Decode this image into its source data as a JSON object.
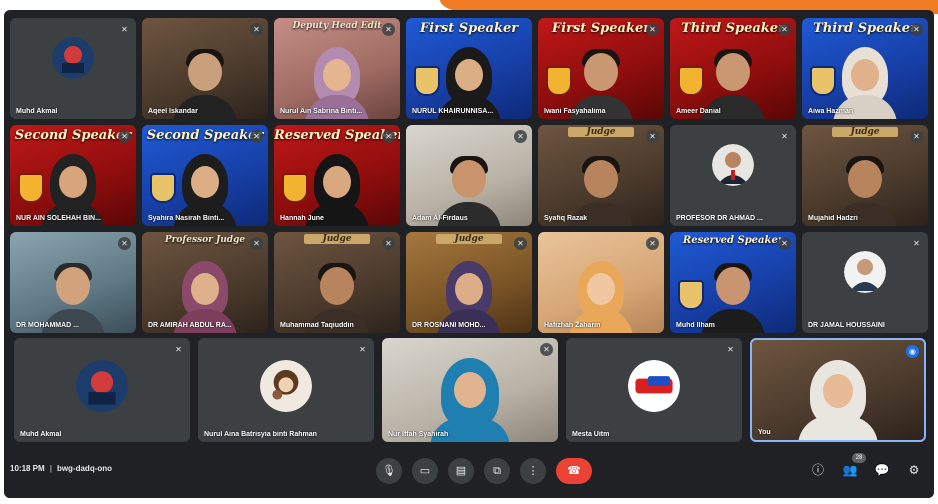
{
  "meeting": {
    "time": "10:18 PM",
    "code": "bwg-dadq-ono"
  },
  "grid_tiles": [
    {
      "name": "Muhd Akmal",
      "kind": "avatar"
    },
    {
      "name": "Aqeel Iskandar",
      "kind": "video"
    },
    {
      "name": "Nurul Ain Sabrina Binti...",
      "kind": "video",
      "banner": "Deputy Head Edit"
    },
    {
      "name": "NURUL KHAIRUNNISA...",
      "kind": "video",
      "banner": "First Speaker",
      "subtitle": "RAW"
    },
    {
      "name": "Iwani Fasyahalima",
      "kind": "video",
      "banner": "First Speaker",
      "subtitle": "DOR"
    },
    {
      "name": "Ameer Danial",
      "kind": "video",
      "banner": "Third Speaker",
      "subtitle": "DOR"
    },
    {
      "name": "Aiwa Hazman",
      "kind": "video",
      "banner": "Third Speaker",
      "subtitle": "RAW"
    },
    {
      "name": "NUR AIN SOLEHAH BIN...",
      "kind": "video",
      "banner": "Second Speaker",
      "subtitle": "GRY"
    },
    {
      "name": "Syahira Nasirah Binti...",
      "kind": "video",
      "banner": "Second Speaker",
      "subtitle": "RAW"
    },
    {
      "name": "Hannah June",
      "kind": "video",
      "banner": "Reserved Speaker",
      "subtitle": "GRY"
    },
    {
      "name": "Adam Al-Firdaus",
      "kind": "video"
    },
    {
      "name": "Syafiq Razak",
      "kind": "video",
      "banner": "Judge"
    },
    {
      "name": "PROFESOR DR AHMAD ...",
      "kind": "photo-avatar"
    },
    {
      "name": "Mujahid Hadzri",
      "kind": "video",
      "banner": "Judge"
    },
    {
      "name": "DR MOHAMMAD ...",
      "kind": "video"
    },
    {
      "name": "DR AMIRAH ABDUL RA...",
      "kind": "video",
      "banner": "Professor Judge"
    },
    {
      "name": "Muhammad Taqiuddin",
      "kind": "video",
      "banner": "Judge"
    },
    {
      "name": "DR ROSNANI MOHD...",
      "kind": "video",
      "banner": "Judge"
    },
    {
      "name": "Hafizhah Zaharin",
      "kind": "video"
    },
    {
      "name": "Muhd Ilham",
      "kind": "video",
      "banner": "Reserved Speaker",
      "subtitle": "RAW"
    },
    {
      "name": "DR JAMAL HOUSSAINI",
      "kind": "photo-avatar"
    }
  ],
  "bottom_tiles": [
    {
      "name": "Muhd Akmal",
      "kind": "avatar"
    },
    {
      "name": "Nurul Aina Batrisyia binti Rahman",
      "kind": "avatar"
    },
    {
      "name": "Nur Iffah Syahirah",
      "kind": "video"
    },
    {
      "name": "Mesta Uitm",
      "kind": "logo-avatar"
    },
    {
      "name": "You",
      "kind": "video",
      "self": true
    }
  ],
  "controls": {
    "mic": "mic-icon",
    "camera": "camera-icon",
    "captions": "captions-icon",
    "present": "present-icon",
    "more": "more-options-icon",
    "leave": "end-call-icon"
  },
  "right_controls": {
    "participants_count": "28"
  },
  "colors": {
    "accent_orange": "#f07b22",
    "meet_bg": "#202124",
    "end_call_red": "#ea4335",
    "speaking_blue": "#1a73e8"
  }
}
